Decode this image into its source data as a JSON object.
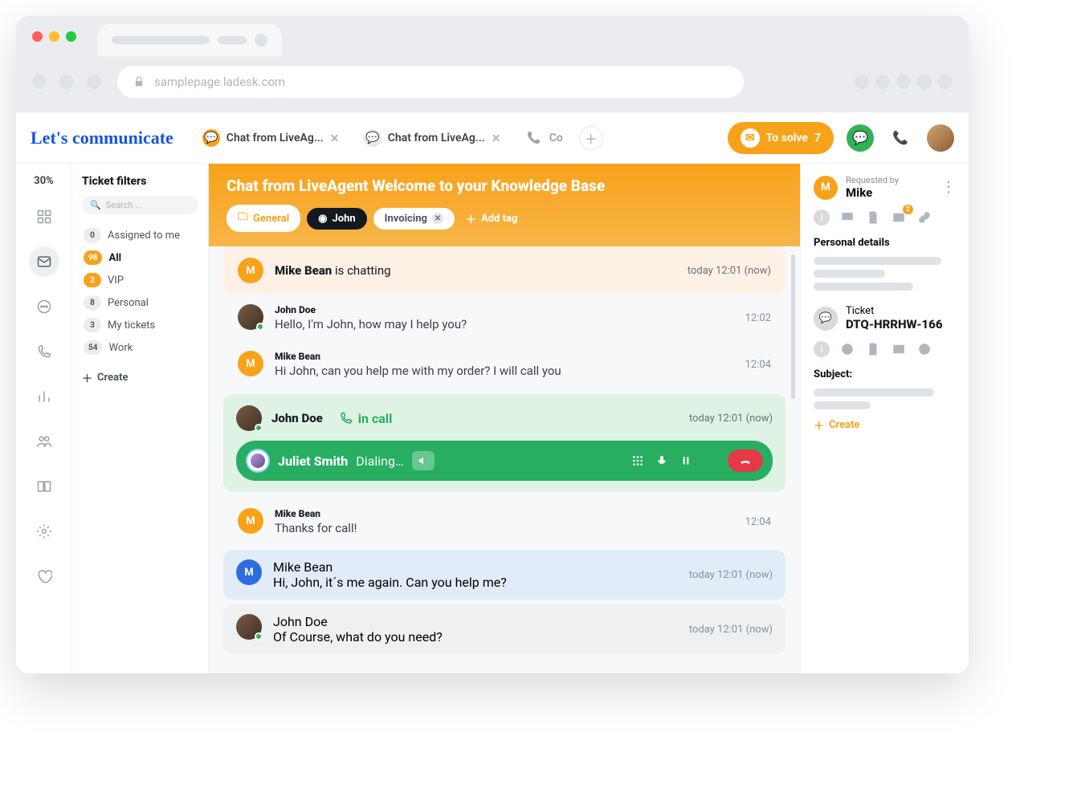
{
  "browser": {
    "url": "samplepage.ladesk.com"
  },
  "brand": "Let's communicate",
  "tabs": [
    {
      "label": "Chat from LiveAg...",
      "variant": "orange"
    },
    {
      "label": "Chat from LiveAg...",
      "variant": "grey"
    },
    {
      "label": "Co",
      "variant": "call"
    }
  ],
  "to_solve": {
    "label": "To solve",
    "count": "7"
  },
  "rail_percent": "30%",
  "filters": {
    "title": "Ticket filters",
    "search_placeholder": "Search ...",
    "items": [
      {
        "count": "0",
        "label": "Assigned to me",
        "active": false,
        "orange": false
      },
      {
        "count": "98",
        "label": "All",
        "active": true,
        "orange": true
      },
      {
        "count": "2",
        "label": "VIP",
        "active": false,
        "orange": true
      },
      {
        "count": "8",
        "label": "Personal",
        "active": false,
        "orange": false
      },
      {
        "count": "3",
        "label": "My tickets",
        "active": false,
        "orange": false
      },
      {
        "count": "54",
        "label": "Work",
        "active": false,
        "orange": false
      }
    ],
    "create": "Create"
  },
  "chat": {
    "title": "Chat from LiveAgent Welcome to your Knowledge Base",
    "tags": {
      "general": "General",
      "john": "John",
      "invoicing": "Invoicing"
    },
    "add_tag": "Add tag",
    "banner": {
      "name": "Mike Bean",
      "status": "is chatting",
      "time": "today 12:01 (now)"
    },
    "messages": [
      {
        "sender": "John Doe",
        "initial": "",
        "av": "j",
        "text": "Hello, I'm John, how may I help you?",
        "time": "12:02"
      },
      {
        "sender": "Mike Bean",
        "initial": "M",
        "av": "m",
        "text": "Hi John, can you help me with my order? I will call you",
        "time": "12:04"
      }
    ],
    "call": {
      "name": "John Doe",
      "status_label": "in call",
      "time": "today 12:01 (now)",
      "dialing_name": "Juliet Smith",
      "dialing_status": "Dialing…"
    },
    "messages2": [
      {
        "sender": "Mike Bean",
        "initial": "M",
        "av": "m",
        "text": "Thanks for call!",
        "time": "12:04",
        "style": "plain"
      },
      {
        "sender": "Mike Bean",
        "initial": "M",
        "av": "m-blue",
        "text": "Hi, John, it´s me again. Can you help me?",
        "time": "today 12:01 (now)",
        "style": "blue"
      },
      {
        "sender": "John Doe",
        "initial": "",
        "av": "j",
        "text": "Of Course, what do you need?",
        "time": "today 12:01 (now)",
        "style": "grey"
      }
    ]
  },
  "side": {
    "requested_by_label": "Requested by",
    "requester": "Mike",
    "personal_details": "Personal details",
    "ticket_label": "Ticket",
    "ticket_id": "DTQ-HRRHW-166",
    "subject": "Subject:",
    "create": "Create",
    "mail_badge": "2"
  }
}
